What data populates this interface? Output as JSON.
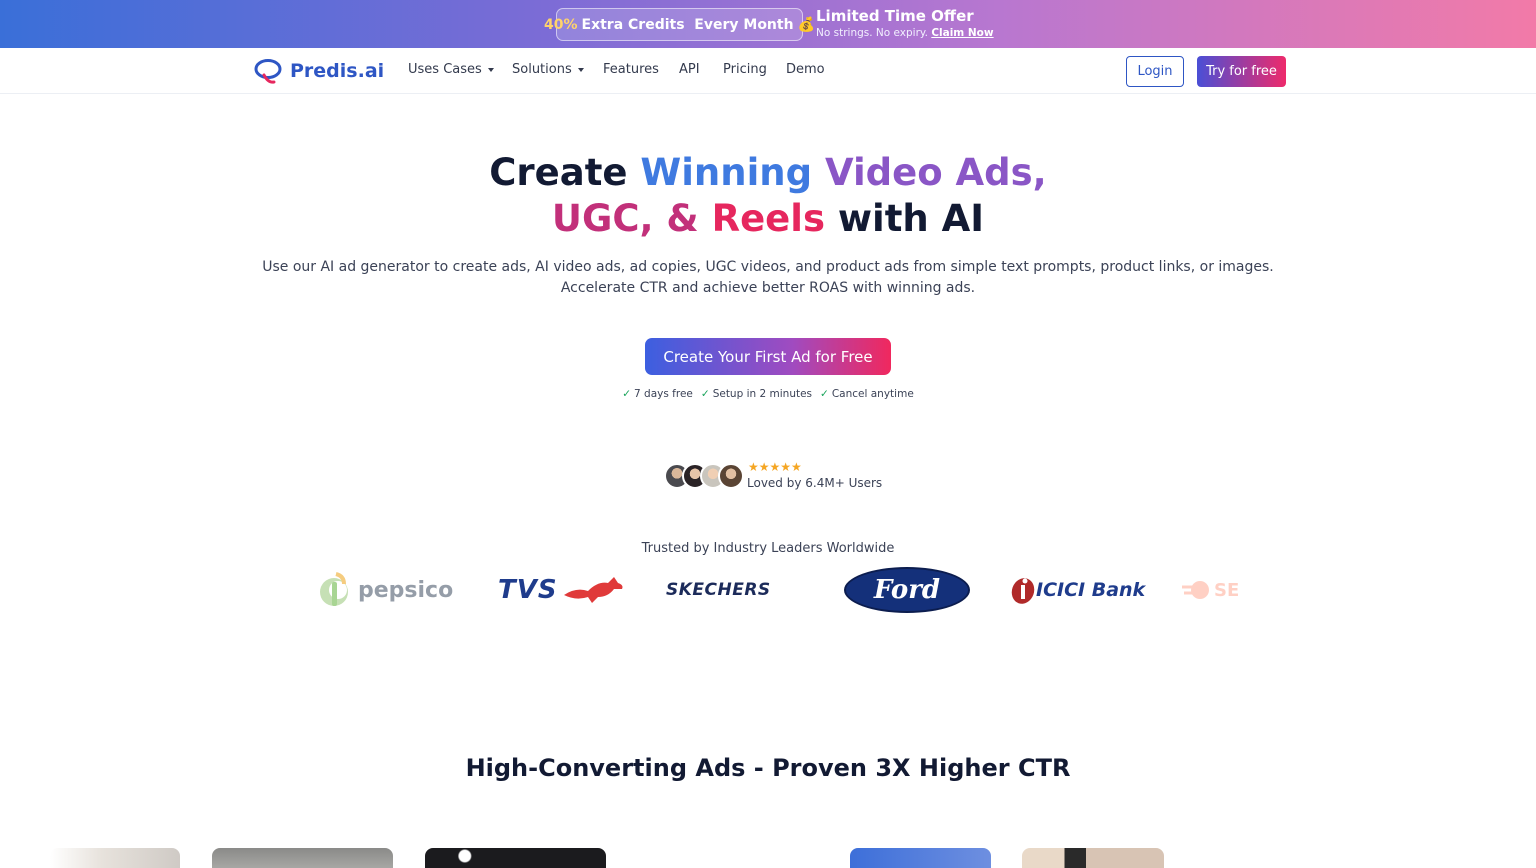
{
  "promo": {
    "pill_highlight": "40%",
    "pill_text": "Extra Credits  Every Month",
    "pill_emoji": "💰",
    "title": "Limited Time Offer",
    "subtitle": "No strings. No expiry.",
    "link": "Claim Now"
  },
  "nav": {
    "brand": "Predis.ai",
    "links": [
      {
        "label": "Uses Cases",
        "dropdown": true
      },
      {
        "label": "Solutions",
        "dropdown": true
      },
      {
        "label": "Features",
        "dropdown": false
      },
      {
        "label": "API",
        "dropdown": false
      },
      {
        "label": "Pricing",
        "dropdown": false
      },
      {
        "label": "Demo",
        "dropdown": false
      }
    ],
    "login": "Login",
    "try": "Try for free"
  },
  "hero": {
    "title_create": "Create",
    "title_winning": "Winning",
    "title_video_ads": "Video Ads,",
    "title_ugc": "UGC, &",
    "title_reels": "Reels",
    "title_with_ai": "with AI",
    "description": "Use our AI ad generator to create ads, AI video ads, ad copies, UGC videos, and product ads from simple text prompts, product links, or images. Accelerate CTR and achieve better ROAS with winning ads.",
    "cta": "Create Your First Ad for Free",
    "perks": [
      "7 days free",
      "Setup in 2 minutes",
      "Cancel anytime"
    ]
  },
  "social_proof": {
    "stars": "★★★★★",
    "rating": 5,
    "loved": "Loved by 6.4M+ Users"
  },
  "trusted": {
    "heading": "Trusted by Industry Leaders Worldwide",
    "logos": [
      "pepsico",
      "TVS",
      "SKECHERS",
      "Ford",
      "ICICI Bank",
      "SE"
    ]
  },
  "section": {
    "title": "High-Converting Ads - Proven 3X Higher CTR"
  },
  "colors": {
    "brand_blue": "#2e56c4",
    "cta_start": "#3c5fe0",
    "cta_end": "#f0285e",
    "check_green": "#18a35a",
    "star_gold": "#f5a623"
  }
}
